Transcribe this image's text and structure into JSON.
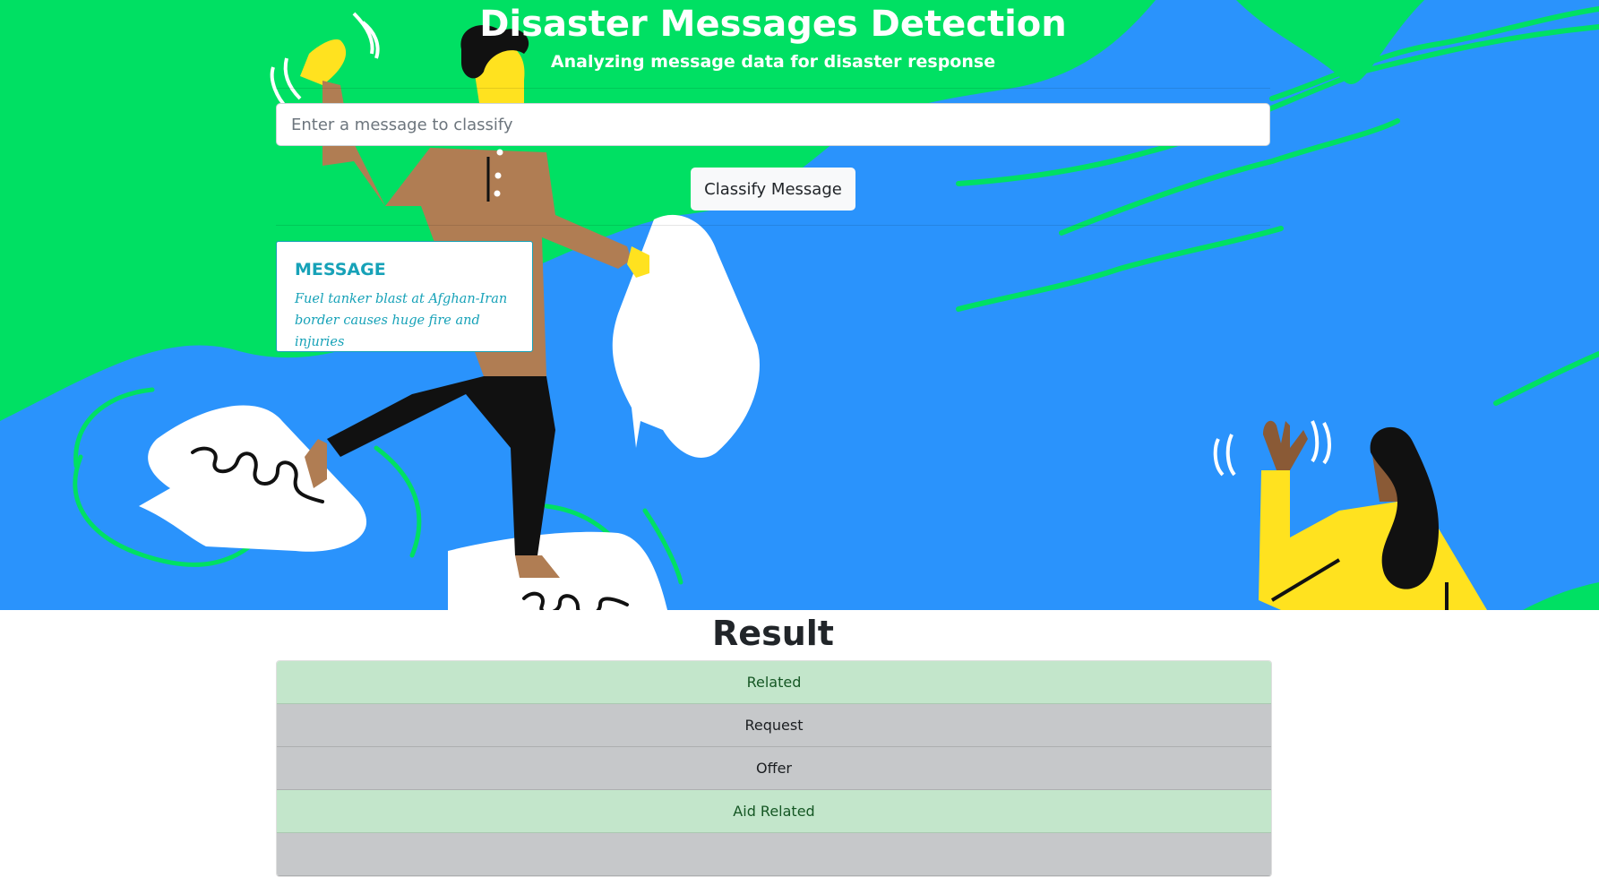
{
  "header": {
    "title": "Disaster Messages Detection",
    "subtitle": "Analyzing message data for disaster response"
  },
  "form": {
    "input_placeholder": "Enter a message to classify",
    "input_value": "",
    "button_label": "Classify Message"
  },
  "message_card": {
    "heading": "MESSAGE",
    "text": "Fuel tanker blast at Afghan-Iran border causes huge fire and injuries"
  },
  "results": {
    "heading": "Result",
    "categories": [
      {
        "label": "Related",
        "status": "positive"
      },
      {
        "label": "Request",
        "status": "negative"
      },
      {
        "label": "Offer",
        "status": "negative"
      },
      {
        "label": "Aid Related",
        "status": "positive"
      }
    ]
  },
  "colors": {
    "hero_blue": "#2a93fc",
    "hero_green": "#00e063",
    "accent_info": "#17a2b8",
    "positive_bg": "#c3e6cb",
    "negative_bg": "#c6c8ca"
  }
}
